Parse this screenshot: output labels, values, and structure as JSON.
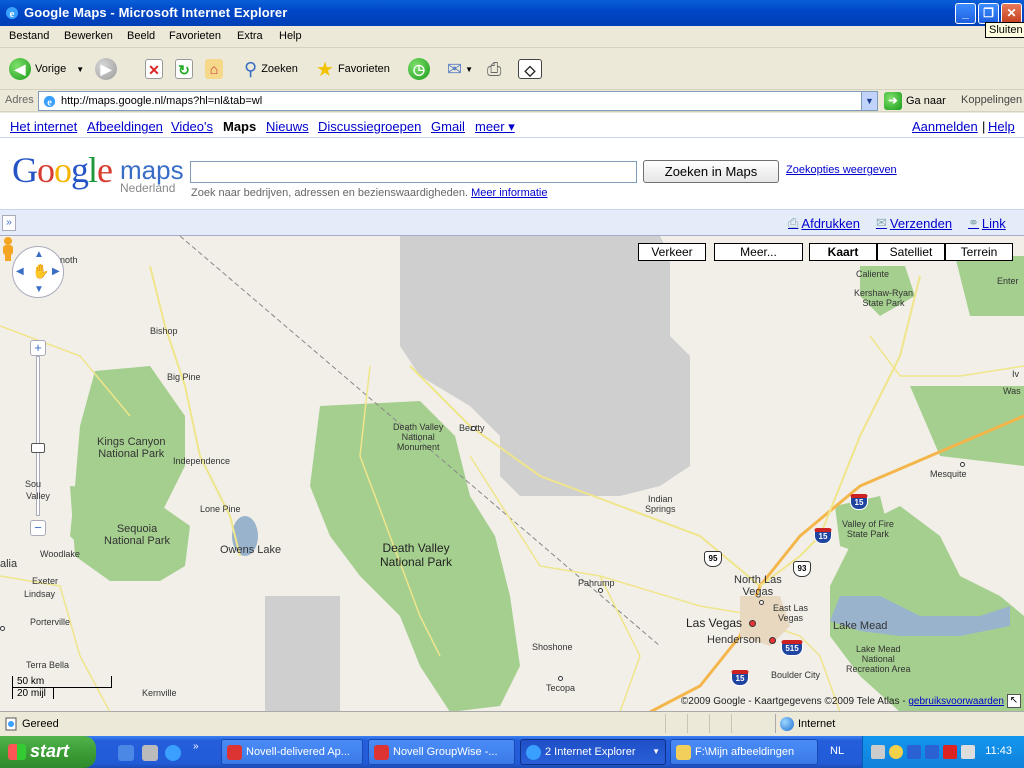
{
  "window": {
    "title": "Google Maps - Microsoft Internet Explorer",
    "tooltip": "Sluiten"
  },
  "menu": [
    "Bestand",
    "Bewerken",
    "Beeld",
    "Favorieten",
    "Extra",
    "Help"
  ],
  "toolbar": {
    "back": "Vorige",
    "search": "Zoeken",
    "favorites": "Favorieten"
  },
  "address": {
    "label": "Adres",
    "url": "http://maps.google.nl/maps?hl=nl&tab=wl",
    "go": "Ga naar",
    "links": "Koppelingen"
  },
  "gbar": {
    "items": [
      "Het internet",
      "Afbeeldingen",
      "Video's",
      "Maps",
      "Nieuws",
      "Discussiegroepen",
      "Gmail",
      "meer ▾"
    ],
    "signin": "Aanmelden",
    "sep": "|",
    "help": "Help"
  },
  "logo": {
    "google": "Google",
    "maps": "maps",
    "country": "Nederland"
  },
  "search": {
    "button": "Zoeken in Maps",
    "options": "Zoekopties weergeven",
    "hint": "Zoek naar bedrijven, adressen en bezienswaardigheden.",
    "hint_link": "Meer informatie"
  },
  "linkbar": {
    "collapse": "»",
    "print": "Afdrukken",
    "send": "Verzenden",
    "link": "Link"
  },
  "map": {
    "buttons": {
      "traffic": "Verkeer",
      "more": "Meer...",
      "map": "Kaart",
      "satellite": "Satelliet",
      "terrain": "Terrein"
    },
    "places": {
      "kings_canyon": "Kings Canyon\nNational Park",
      "sequoia": "Sequoia\nNational Park",
      "death_valley_big": "Death Valley\nNational Park",
      "death_valley_mon": "Death Valley\nNational\nMonument",
      "kershaw": "Kershaw-Ryan\nState Park",
      "valley_fire": "Valley of Fire\nState Park",
      "lake_mead_rec": "Lake Mead\nNational\nRecreation Area",
      "bishop": "Bishop",
      "big_pine": "Big Pine",
      "independence": "Independence",
      "lone_pine": "Lone Pine",
      "owens_lake": "Owens Lake",
      "beatty": "Beatty",
      "indian_springs": "Indian\nSprings",
      "pahrump": "Pahrump",
      "shoshone": "Shoshone",
      "tecopa": "Tecopa",
      "north_las_vegas": "North Las\nVegas",
      "las_vegas": "Las Vegas",
      "east_las_vegas": "East Las\nVegas",
      "henderson": "Henderson",
      "boulder_city": "Boulder City",
      "lake_mead": "Lake Mead",
      "mesquite": "Mesquite",
      "caliente": "Caliente",
      "woodlake": "Woodlake",
      "exeter": "Exeter",
      "lindsay": "Lindsay",
      "porterville": "Porterville",
      "terra_bella": "Terra Bella",
      "kernville": "Kernville",
      "visalia": "alia",
      "valley": "Valley",
      "south": "Sou",
      "north_edge": "noth",
      "wasco_edge": "Was",
      "enter_edge": "Enter",
      "iv_edge": "Iv"
    },
    "shields": {
      "i15a": "15",
      "i15b": "15",
      "i15c": "15",
      "us95": "95",
      "us93": "93",
      "i515": "515"
    },
    "scale": {
      "km": "50 km",
      "mi": "20 mijl"
    },
    "zoom_in": "+",
    "zoom_out": "−",
    "copyright": "©2009 Google - Kaartgegevens ©2009 Tele Atlas -",
    "terms": "gebruiksvoorwaarden"
  },
  "status": {
    "text": "Gereed",
    "zone": "Internet"
  },
  "taskbar": {
    "start": "start",
    "tasks": [
      "Novell-delivered Ap...",
      "Novell GroupWise -...",
      "2 Internet Explorer",
      "F:\\Mijn afbeeldingen"
    ],
    "lang": "NL",
    "clock": "11:43"
  }
}
